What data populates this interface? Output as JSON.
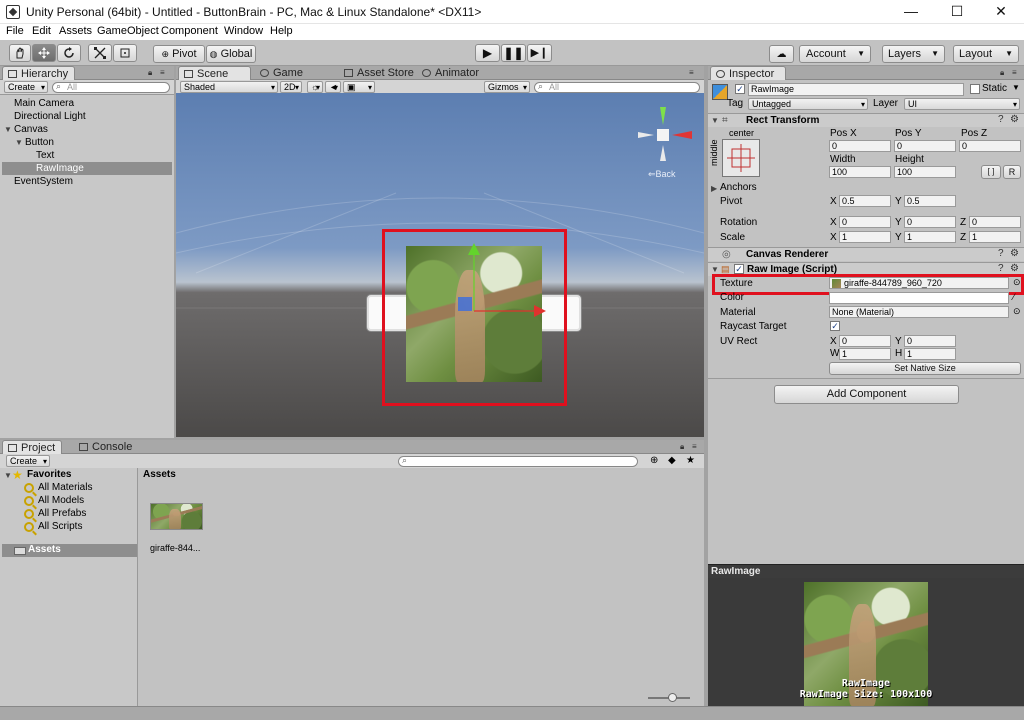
{
  "window": {
    "title": "Unity Personal (64bit) - Untitled - ButtonBrain - PC, Mac & Linux Standalone* <DX11>",
    "minimize": "—",
    "maximize": "☐",
    "close": "✕"
  },
  "menu": [
    "File",
    "Edit",
    "Assets",
    "GameObject",
    "Component",
    "Window",
    "Help"
  ],
  "toolbar": {
    "pivot_label": "Pivot",
    "global_label": "Global",
    "account_label": "Account",
    "layers_label": "Layers",
    "layout_label": "Layout",
    "transform_tools": [
      "hand-icon",
      "move-icon",
      "rotate-icon",
      "scale-icon",
      "rect-icon"
    ]
  },
  "hierarchy": {
    "tab_label": "Hierarchy",
    "create_label": "Create",
    "search_placeholder": "All",
    "items": [
      {
        "label": "Main Camera"
      },
      {
        "label": "Directional Light"
      },
      {
        "label": "Canvas"
      },
      {
        "label": "Button"
      },
      {
        "label": "Text"
      },
      {
        "label": "RawImage"
      },
      {
        "label": "EventSystem"
      }
    ]
  },
  "scene": {
    "tabs": [
      "Scene",
      "Game",
      "Asset Store",
      "Animator"
    ],
    "shading_label": "Shaded",
    "mode_2d": "2D",
    "gizmos_label": "Gizmos",
    "search_placeholder": "All",
    "gizmo_back_label": "Back"
  },
  "inspector": {
    "tab_label": "Inspector",
    "object_name": "RawImage",
    "static_label": "Static",
    "tag_label": "Tag",
    "tag_value": "Untagged",
    "layer_label": "Layer",
    "layer_value": "UI",
    "rect_transform": {
      "title": "Rect Transform",
      "anchor_h": "center",
      "anchor_v": "middle",
      "pos_x_label": "Pos X",
      "pos_y_label": "Pos Y",
      "pos_z_label": "Pos Z",
      "pos_x": "0",
      "pos_y": "0",
      "pos_z": "0",
      "width_label": "Width",
      "height_label": "Height",
      "width": "100",
      "height": "100",
      "blueprint_btn": "[ ]",
      "raw_btn": "R",
      "anchors_label": "Anchors",
      "pivot_label": "Pivot",
      "pivot_x": "0.5",
      "pivot_y": "0.5",
      "rotation_label": "Rotation",
      "rot_x": "0",
      "rot_y": "0",
      "rot_z": "0",
      "scale_label": "Scale",
      "scale_x": "1",
      "scale_y": "1",
      "scale_z": "1",
      "x": "X",
      "y": "Y",
      "z": "Z"
    },
    "canvas_renderer": {
      "title": "Canvas Renderer"
    },
    "raw_image": {
      "title": "Raw Image (Script)",
      "texture_label": "Texture",
      "texture_value": "giraffe-844789_960_720",
      "color_label": "Color",
      "material_label": "Material",
      "material_value": "None (Material)",
      "raycast_label": "Raycast Target",
      "uv_rect_label": "UV Rect",
      "uv_x": "0",
      "uv_y": "0",
      "uv_w": "1",
      "uv_h": "1",
      "x": "X",
      "y": "Y",
      "w": "W",
      "h": "H",
      "set_native_label": "Set Native Size"
    },
    "add_component_label": "Add Component",
    "preview": {
      "header": "RawImage",
      "caption": "RawImage",
      "size_caption": "RawImage Size: 100x100"
    }
  },
  "project": {
    "tabs": [
      "Project",
      "Console"
    ],
    "create_label": "Create",
    "favorites_label": "Favorites",
    "favorites": [
      "All Materials",
      "All Models",
      "All Prefabs",
      "All Scripts"
    ],
    "assets_folder": "Assets",
    "assets_header": "Assets",
    "asset_items": [
      {
        "label": "giraffe-844..."
      }
    ]
  },
  "colors": {
    "highlight": "#e0101e",
    "selection": "#8e8e8e"
  }
}
